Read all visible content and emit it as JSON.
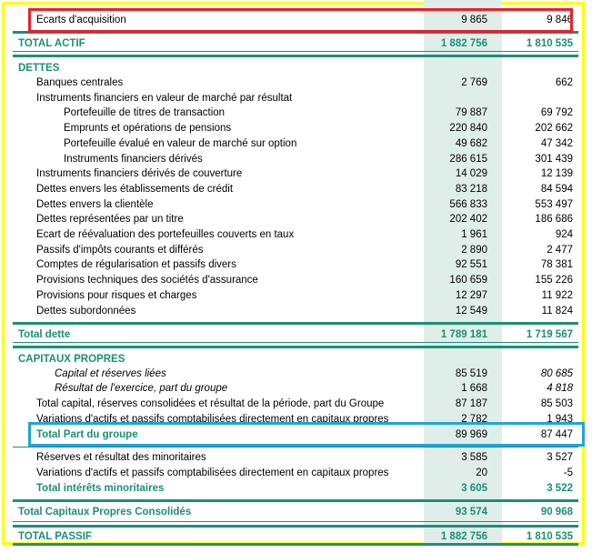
{
  "rows_top": [
    {
      "id": "ecarts",
      "label": "Ecarts d'acquisition",
      "v1": "9 865",
      "v2": "9 846",
      "indent": 26,
      "style": ""
    },
    {
      "id": "total-actif",
      "label": "TOTAL ACTIF",
      "v1": "1 882 756",
      "v2": "1 810 535",
      "indent": 6,
      "style": "bold green"
    }
  ],
  "dettes_header": "DETTES",
  "dettes": [
    {
      "label": "Banques centrales",
      "v1": "2 769",
      "v2": "662",
      "indent": 26,
      "style": ""
    },
    {
      "label": "Instruments financiers en valeur de marché par résultat",
      "v1": "",
      "v2": "",
      "indent": 26,
      "style": ""
    },
    {
      "label": "Portefeuille de titres de transaction",
      "v1": "79 887",
      "v2": "69 792",
      "indent": 56,
      "style": ""
    },
    {
      "label": "Emprunts et opérations de pensions",
      "v1": "220 840",
      "v2": "202 662",
      "indent": 56,
      "style": ""
    },
    {
      "label": "Portefeuille évalué en valeur de marché sur option",
      "v1": "49 682",
      "v2": "47 342",
      "indent": 56,
      "style": ""
    },
    {
      "label": "Instruments financiers dérivés",
      "v1": "286 615",
      "v2": "301 439",
      "indent": 56,
      "style": ""
    },
    {
      "label": "Instruments financiers dérivés de couverture",
      "v1": "14 029",
      "v2": "12 139",
      "indent": 26,
      "style": ""
    },
    {
      "label": "Dettes envers les établissements de crédit",
      "v1": "83 218",
      "v2": "84 594",
      "indent": 26,
      "style": ""
    },
    {
      "label": "Dettes envers la clientèle",
      "v1": "566 833",
      "v2": "553 497",
      "indent": 26,
      "style": ""
    },
    {
      "label": "Dettes représentées par un titre",
      "v1": "202 402",
      "v2": "186 686",
      "indent": 26,
      "style": ""
    },
    {
      "label": "Ecart de réévaluation des portefeuilles couverts en taux",
      "v1": "1 961",
      "v2": "924",
      "indent": 26,
      "style": ""
    },
    {
      "label": "Passifs d'impôts courants et différés",
      "v1": "2 890",
      "v2": "2 477",
      "indent": 26,
      "style": ""
    },
    {
      "label": "Comptes de régularisation et passifs divers",
      "v1": "92 551",
      "v2": "78 381",
      "indent": 26,
      "style": ""
    },
    {
      "label": "Provisions techniques des sociétés d'assurance",
      "v1": "160 659",
      "v2": "155 226",
      "indent": 26,
      "style": ""
    },
    {
      "label": "Provisions pour risques et charges",
      "v1": "12 297",
      "v2": "11 922",
      "indent": 26,
      "style": ""
    },
    {
      "label": "Dettes subordonnées",
      "v1": "12 549",
      "v2": "11 824",
      "indent": 26,
      "style": ""
    }
  ],
  "total_dette": {
    "label": "Total dette",
    "v1": "1 789 181",
    "v2": "1 719 567"
  },
  "capitaux_header": "CAPITAUX PROPRES",
  "capitaux": [
    {
      "label": "Capital et réserves liées",
      "v1": "85 519",
      "v2": "80 685",
      "indent": 46,
      "style": "ital",
      "v2style": "ital"
    },
    {
      "label": "Résultat de l'exercice, part du groupe",
      "v1": "1 668",
      "v2": "4 818",
      "indent": 46,
      "style": "ital",
      "v2style": "ital"
    },
    {
      "label": "Total capital, réserves consolidées et résultat de la période, part du Groupe",
      "v1": "87 187",
      "v2": "85 503",
      "indent": 26,
      "style": "",
      "v2style": ""
    },
    {
      "label": "Variations d'actifs et passifs comptabilisées directement en capitaux propres",
      "v1": "2 782",
      "v2": "1 943",
      "indent": 26,
      "style": "",
      "v2style": ""
    }
  ],
  "total_part_groupe": {
    "label": "Total Part du groupe",
    "v1": "89 969",
    "v2": "87 447"
  },
  "minoritaires": [
    {
      "label": "Réserves et résultat des minoritaires",
      "v1": "3 585",
      "v2": "3 527",
      "indent": 26,
      "style": ""
    },
    {
      "label": "Variations d'actifs et passifs comptabilisées directement en capitaux propres",
      "v1": "20",
      "v2": "-5",
      "indent": 26,
      "style": ""
    },
    {
      "label": "Total intérêts minoritaires",
      "v1": "3 605",
      "v2": "3 522",
      "indent": 26,
      "style": "bold green"
    }
  ],
  "total_capitaux": {
    "label": "Total Capitaux Propres Consolidés",
    "v1": "93 574",
    "v2": "90 968"
  },
  "total_passif": {
    "label": "TOTAL PASSIF",
    "v1": "1 882 756",
    "v2": "1 810 535"
  },
  "colors": {
    "accent": "#1d8f73",
    "shade": "#e0eeea",
    "red_box": "#e8202a",
    "blue_box": "#1fa3e0",
    "yellow_frame": "#ffff00"
  }
}
